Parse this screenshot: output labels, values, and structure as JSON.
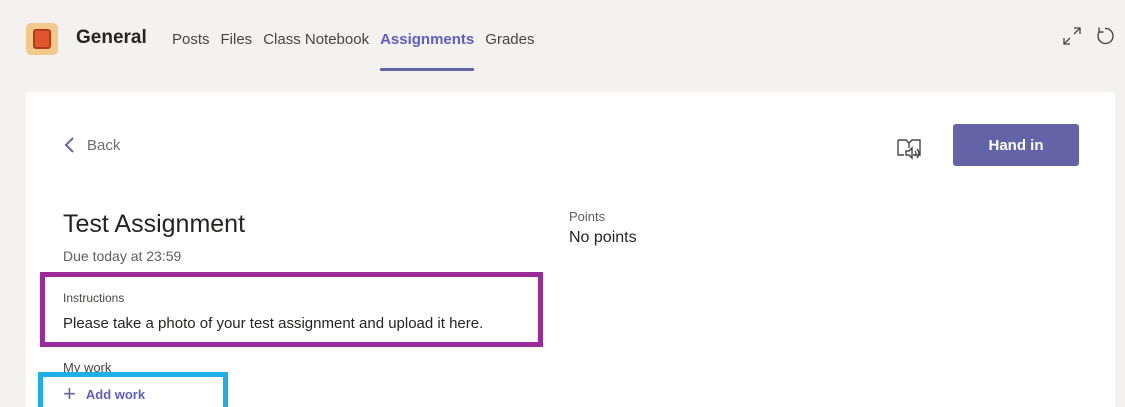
{
  "header": {
    "channel_name": "General",
    "tabs": [
      {
        "label": "Posts",
        "active": false
      },
      {
        "label": "Files",
        "active": false
      },
      {
        "label": "Class Notebook",
        "active": false
      },
      {
        "label": "Assignments",
        "active": true
      },
      {
        "label": "Grades",
        "active": false
      }
    ],
    "icons": [
      "expand-icon",
      "refresh-icon"
    ]
  },
  "assignment": {
    "back_label": "Back",
    "hand_in_label": "Hand in",
    "title": "Test Assignment",
    "due": "Due today at 23:59",
    "points_label": "Points",
    "points_value": "No points",
    "instructions_label": "Instructions",
    "instructions_text": "Please take a photo of your test assignment and upload it here.",
    "my_work_label": "My work",
    "add_work_label": "Add work"
  },
  "colors": {
    "accent": "#6264a7",
    "instructions_highlight": "#9b2a9b",
    "add_work_highlight": "#1eaee8"
  }
}
